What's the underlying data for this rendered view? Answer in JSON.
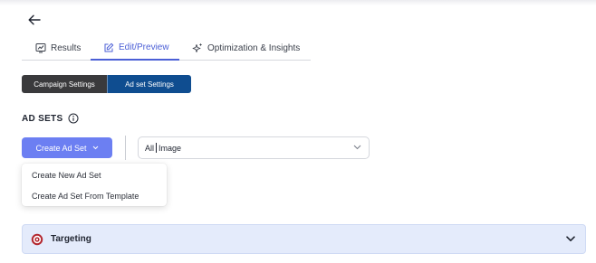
{
  "tabs": [
    {
      "label": "Results",
      "icon": "chart-icon"
    },
    {
      "label": "Edit/Preview",
      "icon": "edit-icon",
      "active": true
    },
    {
      "label": "Optimization & Insights",
      "icon": "sparkle-icon"
    }
  ],
  "toggle": {
    "campaign_settings": "Campaign Settings",
    "adset_settings": "Ad set Settings"
  },
  "section": {
    "title": "AD SETS"
  },
  "create_button": {
    "label": "Create Ad Set"
  },
  "filter": {
    "prefix": "All",
    "value": "Image"
  },
  "dropdown": {
    "items": [
      "Create New Ad Set",
      "Create Ad Set From Template"
    ]
  },
  "targeting": {
    "label": "Targeting"
  },
  "colors": {
    "accent": "#4b5fd6",
    "create_button": "#6c7ff2",
    "adset_toggle": "#0f4d90",
    "campaign_toggle": "#3a3a3c",
    "accordion_bg": "#e4ebfb",
    "target_icon": "#b3262e"
  }
}
